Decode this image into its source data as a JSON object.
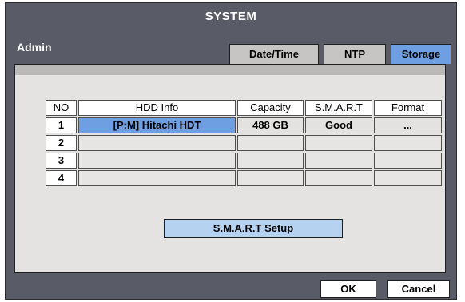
{
  "window": {
    "title": "SYSTEM"
  },
  "user": {
    "label": "Admin"
  },
  "tabs": [
    {
      "label": "Date/Time",
      "active": false
    },
    {
      "label": "NTP",
      "active": false
    },
    {
      "label": "Storage",
      "active": true
    }
  ],
  "table": {
    "headers": [
      "NO",
      "HDD Info",
      "Capacity",
      "S.M.A.R.T",
      "Format"
    ],
    "rows": [
      {
        "no": "1",
        "hdd_info": "[P:M] Hitachi HDT",
        "capacity": "488 GB",
        "smart": "Good",
        "format": "..."
      },
      {
        "no": "2",
        "hdd_info": "",
        "capacity": "",
        "smart": "",
        "format": ""
      },
      {
        "no": "3",
        "hdd_info": "",
        "capacity": "",
        "smart": "",
        "format": ""
      },
      {
        "no": "4",
        "hdd_info": "",
        "capacity": "",
        "smart": "",
        "format": ""
      }
    ]
  },
  "buttons": {
    "smart_setup": "S.M.A.R.T Setup",
    "ok": "OK",
    "cancel": "Cancel"
  },
  "colors": {
    "window_bg": "#595b66",
    "panel_bg": "#e4e3e1",
    "accent_blue": "#6d9fe2",
    "button_light_blue": "#b5d3f1"
  }
}
